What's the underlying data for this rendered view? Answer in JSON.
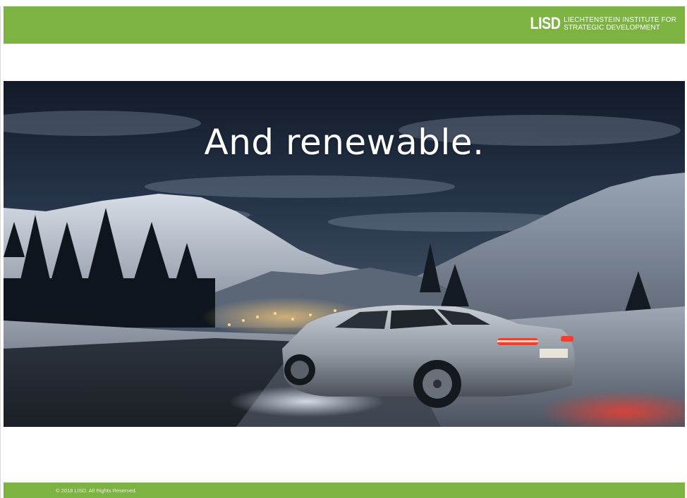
{
  "header": {
    "brand_logo": "LISD",
    "brand_line1": "LIECHTENSTEIN INSTITUTE FOR",
    "brand_line2": "STRATEGIC DEVELOPMENT",
    "bar_color": "#7cb342"
  },
  "slide": {
    "headline": "And renewable.",
    "image_subject": "night-mountain-village-electric-car-photo"
  },
  "footer": {
    "copyright": "© 2018 LISD. All Rights Reserved.",
    "bar_color": "#7cb342"
  }
}
